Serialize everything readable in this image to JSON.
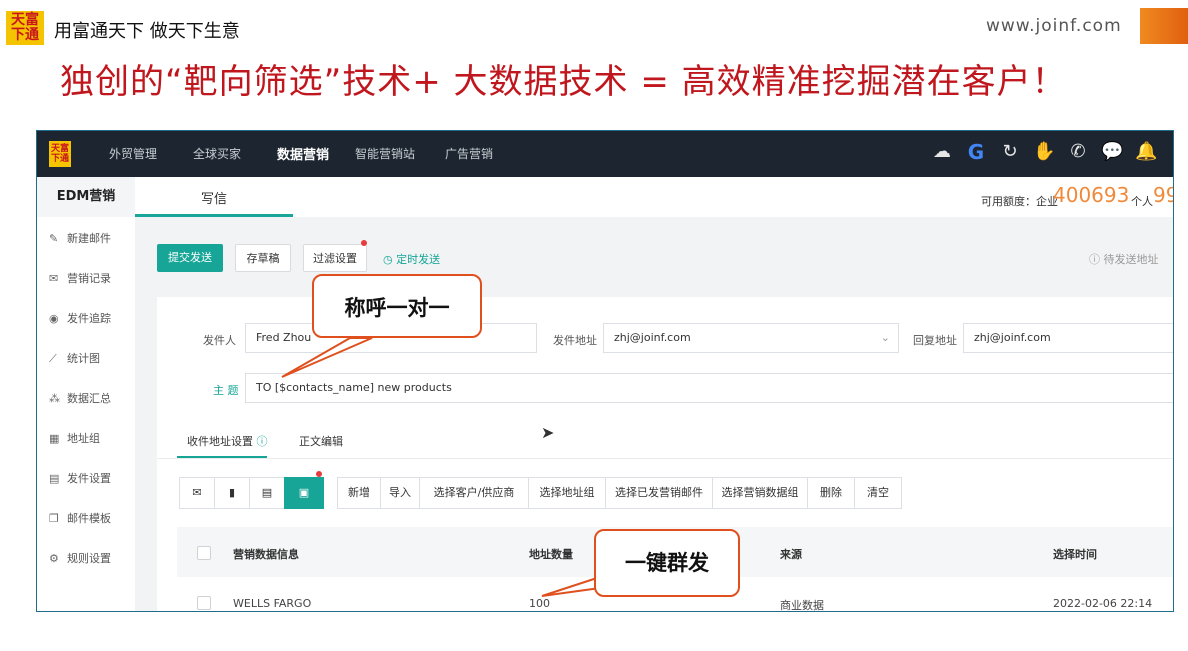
{
  "banner": {
    "logo_line1": "天富",
    "logo_line2": "下通",
    "slogan": "用富通天下 做天下生意",
    "site": "www.joinf.com",
    "headline": "独创的“靶向筛选”技术+ 大数据技术 = 高效精准挖掘潜在客户！"
  },
  "topnav": {
    "items": [
      "外贸管理",
      "全球买家",
      "数据营销",
      "智能营销站",
      "广告营销"
    ],
    "active": "数据营销",
    "icons": [
      "cloud-icon",
      "google-icon",
      "refresh-icon",
      "hand-icon",
      "whatsapp-icon",
      "chat-icon",
      "bell-icon"
    ]
  },
  "sidebar": {
    "title": "EDM营销",
    "items": [
      {
        "label": "新建邮件",
        "icon": "compose-icon"
      },
      {
        "label": "营销记录",
        "icon": "mail-icon"
      },
      {
        "label": "发件追踪",
        "icon": "location-icon"
      },
      {
        "label": "统计图",
        "icon": "chart-icon"
      },
      {
        "label": "数据汇总",
        "icon": "group-icon"
      },
      {
        "label": "地址组",
        "icon": "grid-icon"
      },
      {
        "label": "发件设置",
        "icon": "file-icon"
      },
      {
        "label": "邮件模板",
        "icon": "template-icon"
      },
      {
        "label": "规则设置",
        "icon": "gear-icon"
      }
    ]
  },
  "header": {
    "tab": "写信",
    "quota_label": "可用额度：企业",
    "quota_enterprise": "400693",
    "quota_personal_label": "个人",
    "quota_personal": "99"
  },
  "actions": {
    "submit": "提交发送",
    "draft": "存草稿",
    "filter": "过滤设置",
    "timed": "定时发送",
    "pending": "待发送地址"
  },
  "form": {
    "sender_label": "发件人",
    "sender_value": "Fred Zhou",
    "from_label": "发件地址",
    "from_value": "zhj@joinf.com",
    "reply_label": "回复地址",
    "reply_value": "zhj@joinf.com",
    "subject_label": "主 题",
    "subject_value": "TO [$contacts_name] new products"
  },
  "subtabs": {
    "recipients": "收件地址设置",
    "body": "正文编辑"
  },
  "toolbar": {
    "buttons": [
      "新增",
      "导入",
      "选择客户/供应商",
      "选择地址组",
      "选择已发营销邮件",
      "选择营销数据组",
      "删除",
      "清空"
    ]
  },
  "table": {
    "headers": [
      "营销数据信息",
      "地址数量",
      "来源",
      "选择时间"
    ],
    "rows": [
      {
        "name": "WELLS FARGO",
        "count": "100",
        "source": "商业数据",
        "time": "2022-02-06 22:14"
      }
    ]
  },
  "callouts": {
    "greeting": "称呼一对一",
    "oneclick": "一键群发"
  },
  "colors": {
    "accent": "#16a596",
    "headline": "#c0161d",
    "callout_border": "#e0501e",
    "quota": "#f08a3a"
  }
}
